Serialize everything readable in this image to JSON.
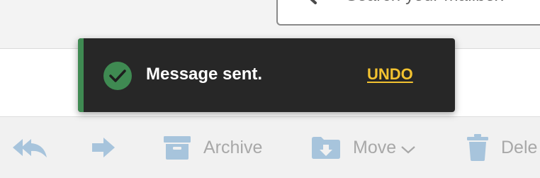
{
  "search": {
    "placeholder": "Search your mailbox",
    "icon": "search-icon"
  },
  "toast": {
    "message": "Message sent.",
    "action_label": "UNDO",
    "icon": "check-circle-icon",
    "accent_color": "#3f8a52",
    "action_color": "#f2c230"
  },
  "toolbar": {
    "icon_color": "#a7c4dc",
    "items": [
      {
        "name": "reply-all",
        "icon": "reply-all-icon",
        "label": ""
      },
      {
        "name": "forward",
        "icon": "forward-icon",
        "label": ""
      },
      {
        "name": "archive",
        "icon": "archive-icon",
        "label": "Archive"
      },
      {
        "name": "move",
        "icon": "folder-move-icon",
        "label": "Move"
      },
      {
        "name": "delete",
        "icon": "trash-icon",
        "label": "Dele"
      }
    ]
  }
}
